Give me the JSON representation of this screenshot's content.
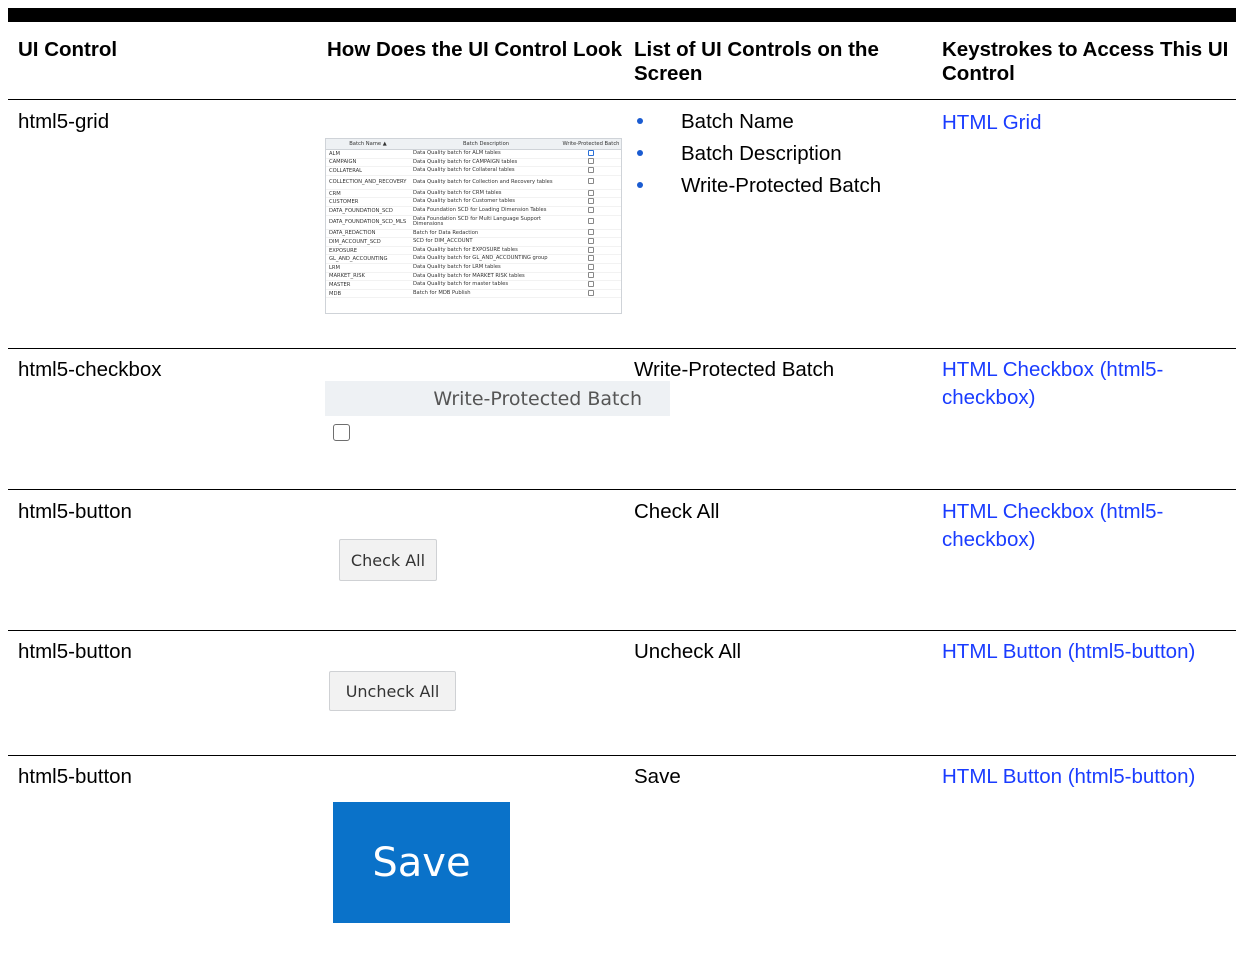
{
  "headers": {
    "col1": "UI Control",
    "col2": "How Does the UI Control Look",
    "col3": "List of UI Controls on the Screen",
    "col4": "Keystrokes to Access This UI Control"
  },
  "rows": [
    {
      "control": "html5-grid",
      "list": [
        "Batch Name",
        "Batch Description",
        "Write-Protected Batch"
      ],
      "link": "HTML Grid"
    },
    {
      "control": "html5-checkbox",
      "list_text": "Write-Protected Batch",
      "link": "HTML Checkbox (html5-checkbox)"
    },
    {
      "control": "html5-button",
      "list_text": "Check All",
      "link": "HTML Checkbox (html5-checkbox)"
    },
    {
      "control": "html5-button",
      "list_text": "Uncheck All",
      "link": "HTML Button (html5-button)"
    },
    {
      "control": "html5-button",
      "list_text": "Save",
      "link": "HTML Button (html5-button)"
    }
  ],
  "grid_thumbnail": {
    "headers": [
      "Batch Name",
      "Batch Description",
      "Write-Protected Batch"
    ],
    "sort_icon": "sort-up-icon",
    "rows": [
      [
        "ALM",
        "Data Quality batch for ALM tables"
      ],
      [
        "CAMPAIGN",
        "Data Quality batch for CAMPAIGN tables"
      ],
      [
        "COLLATERAL",
        "Data Quality batch for Collateral tables"
      ],
      [
        "COLLECTION_AND_RECOVERY",
        "Data Quality batch for Collection and Recovery tables"
      ],
      [
        "CRM",
        "Data Quality batch for CRM tables"
      ],
      [
        "CUSTOMER",
        "Data Quality batch for Customer tables"
      ],
      [
        "DATA_FOUNDATION_SCD",
        "Data Foundation SCD for Loading Dimension Tables"
      ],
      [
        "DATA_FOUNDATION_SCD_MLS",
        "Data Foundation SCD for Multi Language Support Dimensions"
      ],
      [
        "DATA_REDACTION",
        "Batch for Data Redaction"
      ],
      [
        "DIM_ACCOUNT_SCD",
        "SCD for DIM_ACCOUNT"
      ],
      [
        "EXPOSURE",
        "Data Quality batch for EXPOSURE tables"
      ],
      [
        "GL_AND_ACCOUNTING",
        "Data Quality batch for GL_AND_ACCOUNTING group"
      ],
      [
        "LRM",
        "Data Quality batch for LRM tables"
      ],
      [
        "MARKET_RISK",
        "Data Quality batch for MARKET RISK tables"
      ],
      [
        "MASTER",
        "Data Quality batch for master tables"
      ],
      [
        "MDB",
        "Batch for MDB Publish"
      ]
    ]
  },
  "checkbox_thumbnail": {
    "header": "Write-Protected Batch"
  },
  "buttons": {
    "check_all": "Check All",
    "uncheck_all": "Uncheck All",
    "save": "Save"
  },
  "colors": {
    "link": "#1a3cff",
    "save_button": "#0a72c9",
    "bullet": "#1a5bd1"
  }
}
